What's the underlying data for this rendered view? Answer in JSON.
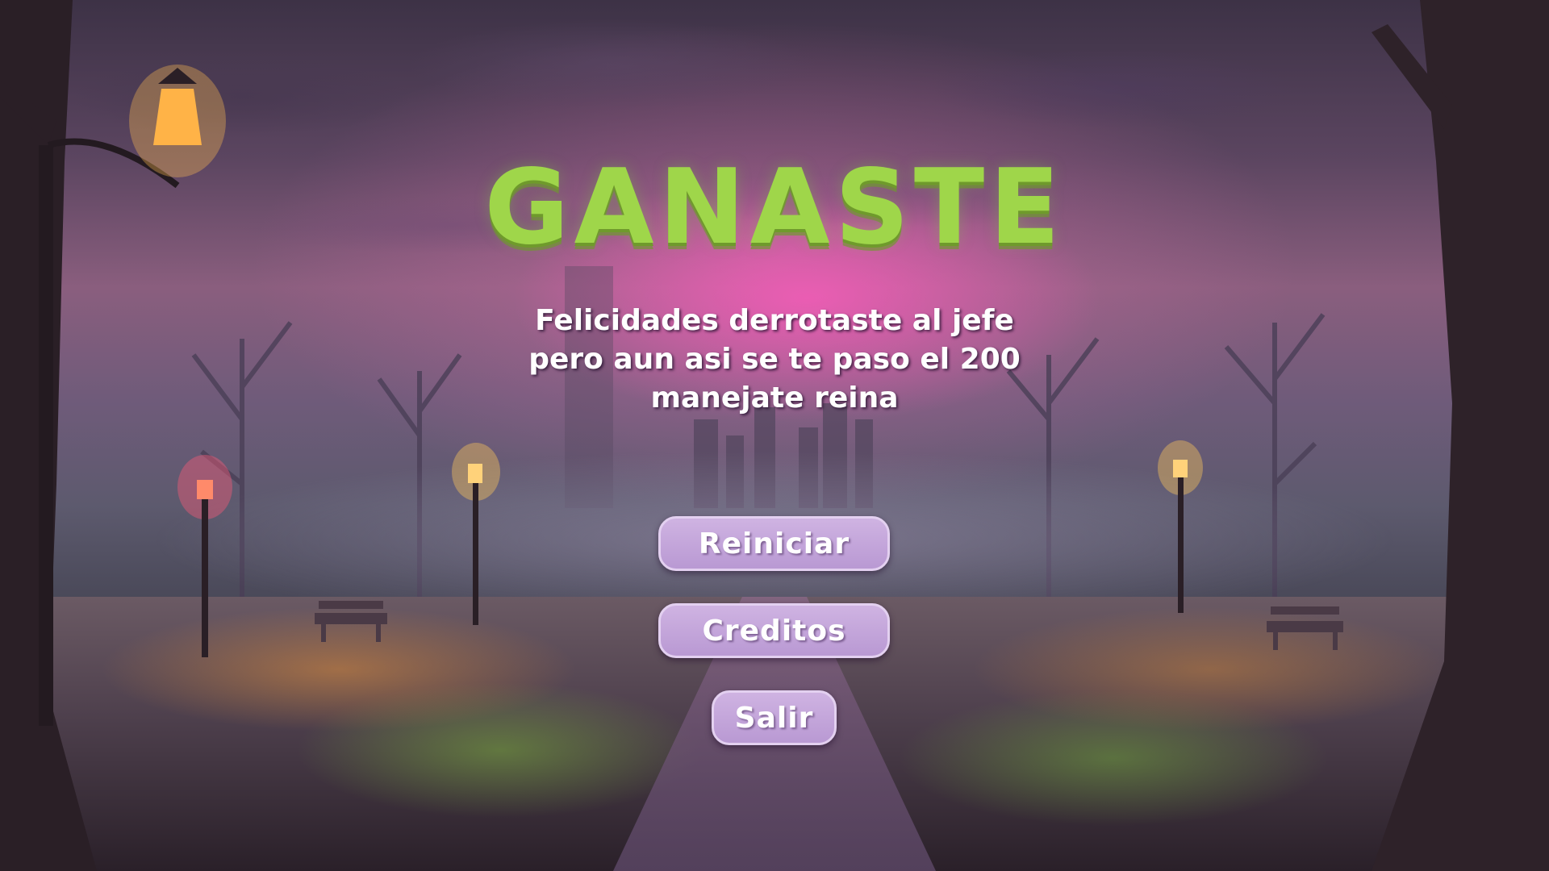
{
  "screen": {
    "title": "GANASTE",
    "message_lines": [
      "Felicidades derrotaste al jefe",
      "pero aun asi se te paso el 200",
      "manejate reina"
    ]
  },
  "menu": {
    "restart_label": "Reiniciar",
    "credits_label": "Creditos",
    "exit_label": "Salir"
  },
  "colors": {
    "title": "#9fd64a",
    "button_fill": "#c4a6da",
    "button_text": "#ffffff",
    "lamp_glow": "#ffb347"
  },
  "scene": {
    "icons": [
      "street-lamp-icon",
      "bench-icon",
      "bare-tree-icon"
    ]
  }
}
